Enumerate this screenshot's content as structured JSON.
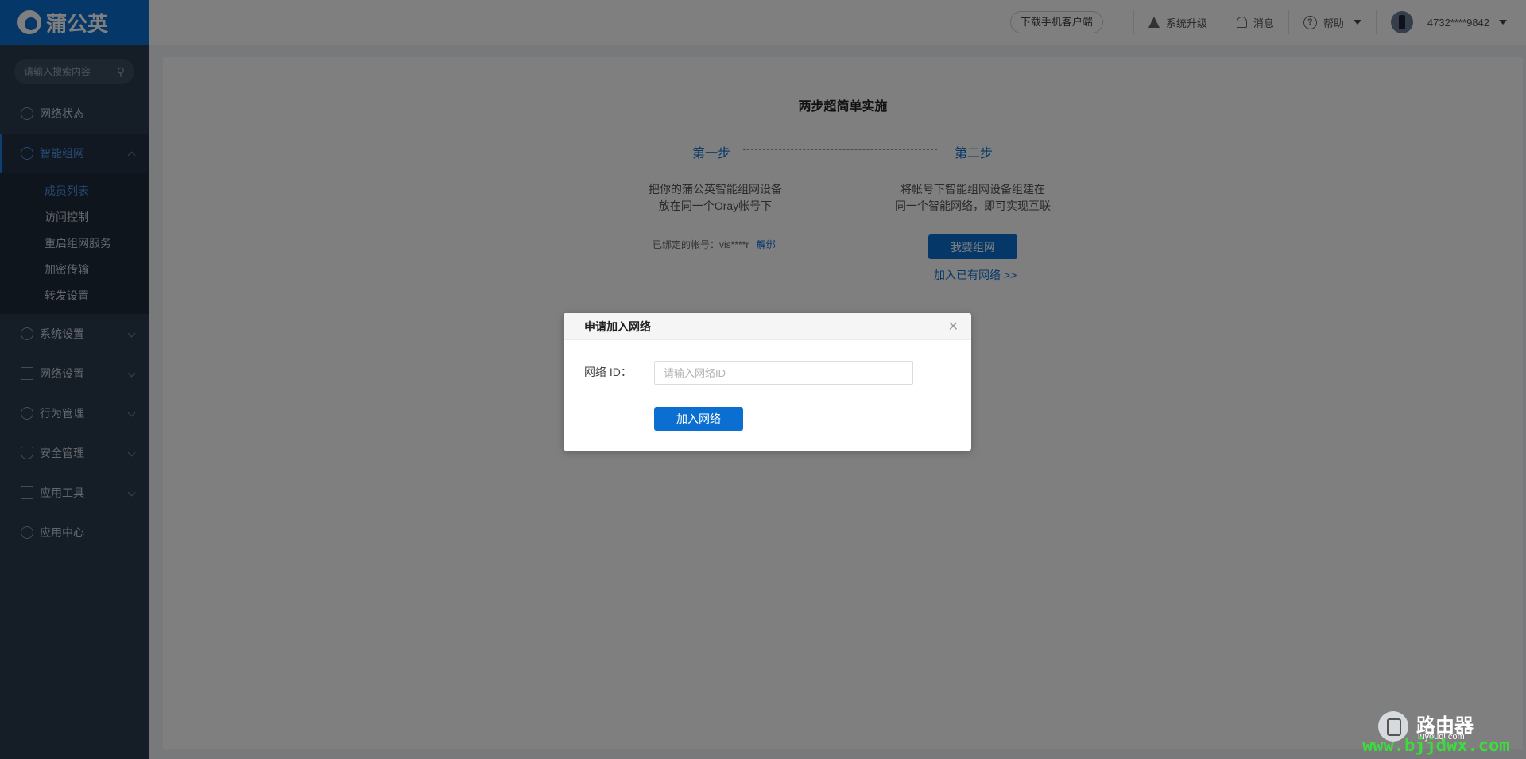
{
  "sidebar": {
    "logo_text": "蒲公英",
    "search_placeholder": "请输入搜索内容",
    "items": [
      {
        "label": "网络状态",
        "icon": "globe-icon"
      },
      {
        "label": "智能组网",
        "icon": "network-icon",
        "active": true,
        "children": [
          {
            "label": "成员列表",
            "active": true
          },
          {
            "label": "访问控制"
          },
          {
            "label": "重启组网服务"
          },
          {
            "label": "加密传输"
          },
          {
            "label": "转发设置"
          }
        ]
      },
      {
        "label": "系统设置",
        "icon": "gear-icon"
      },
      {
        "label": "网络设置",
        "icon": "grid-icon"
      },
      {
        "label": "行为管理",
        "icon": "behavior-icon"
      },
      {
        "label": "安全管理",
        "icon": "shield-icon"
      },
      {
        "label": "应用工具",
        "icon": "toolbox-icon"
      },
      {
        "label": "应用中心",
        "icon": "apps-icon"
      }
    ]
  },
  "topbar": {
    "download_label": "下载手机客户端",
    "upgrade_label": "系统升级",
    "messages_label": "消息",
    "help_label": "帮助",
    "account_label": "4732****9842"
  },
  "main": {
    "title": "两步超简单实施",
    "step1_label": "第一步",
    "step2_label": "第二步",
    "step1_desc_line1": "把你的蒲公英智能组网设备",
    "step1_desc_line2": "放在同一个Oray帐号下",
    "step2_desc_line1": "将帐号下智能组网设备组建在",
    "step2_desc_line2": "同一个智能网络，即可实现互联",
    "bound_account": "已绑定的帐号：vis****r",
    "unbind_label": "解绑",
    "create_network_button": "我要组网",
    "join_existing_link": "加入已有网络 >>"
  },
  "dialog": {
    "title": "申请加入网络",
    "field_label": "网络 ID：",
    "input_placeholder": "请输入网络ID",
    "input_value": "",
    "submit_label": "加入网络"
  },
  "watermark": {
    "title": "路由器",
    "subtitle": "luyouqi.com",
    "url": "www.bjjdwx.com"
  }
}
